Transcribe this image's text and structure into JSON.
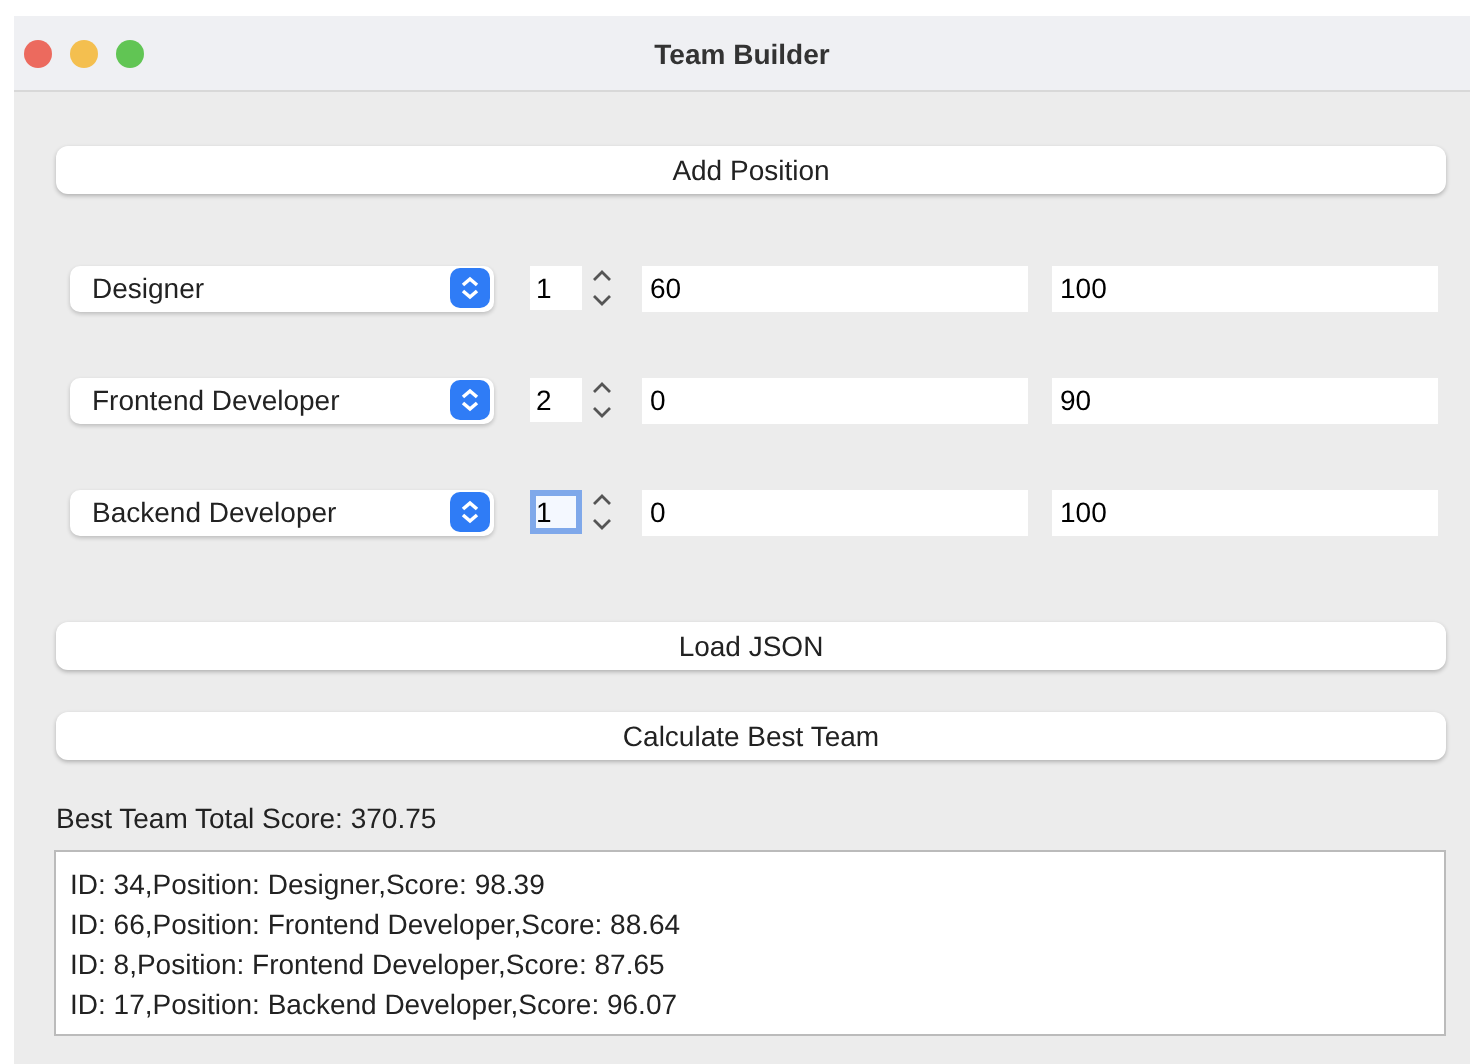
{
  "window": {
    "title": "Team Builder"
  },
  "add_button": "Add Position",
  "positions": [
    {
      "role": "Designer",
      "count": "1",
      "min": "60",
      "max": "100",
      "focused": false
    },
    {
      "role": "Frontend Developer",
      "count": "2",
      "min": "0",
      "max": "90",
      "focused": false
    },
    {
      "role": "Backend Developer",
      "count": "1",
      "min": "0",
      "max": "100",
      "focused": true
    }
  ],
  "load_button": "Load JSON",
  "calculate_button": "Calculate Best Team",
  "total_label": "Best Team Total Score: 370.75",
  "results": [
    "ID: 34,Position: Designer,Score: 98.39",
    "ID: 66,Position: Frontend Developer,Score: 88.64",
    "ID: 8,Position: Frontend Developer,Score: 87.65",
    "ID: 17,Position: Backend Developer,Score: 96.07"
  ]
}
